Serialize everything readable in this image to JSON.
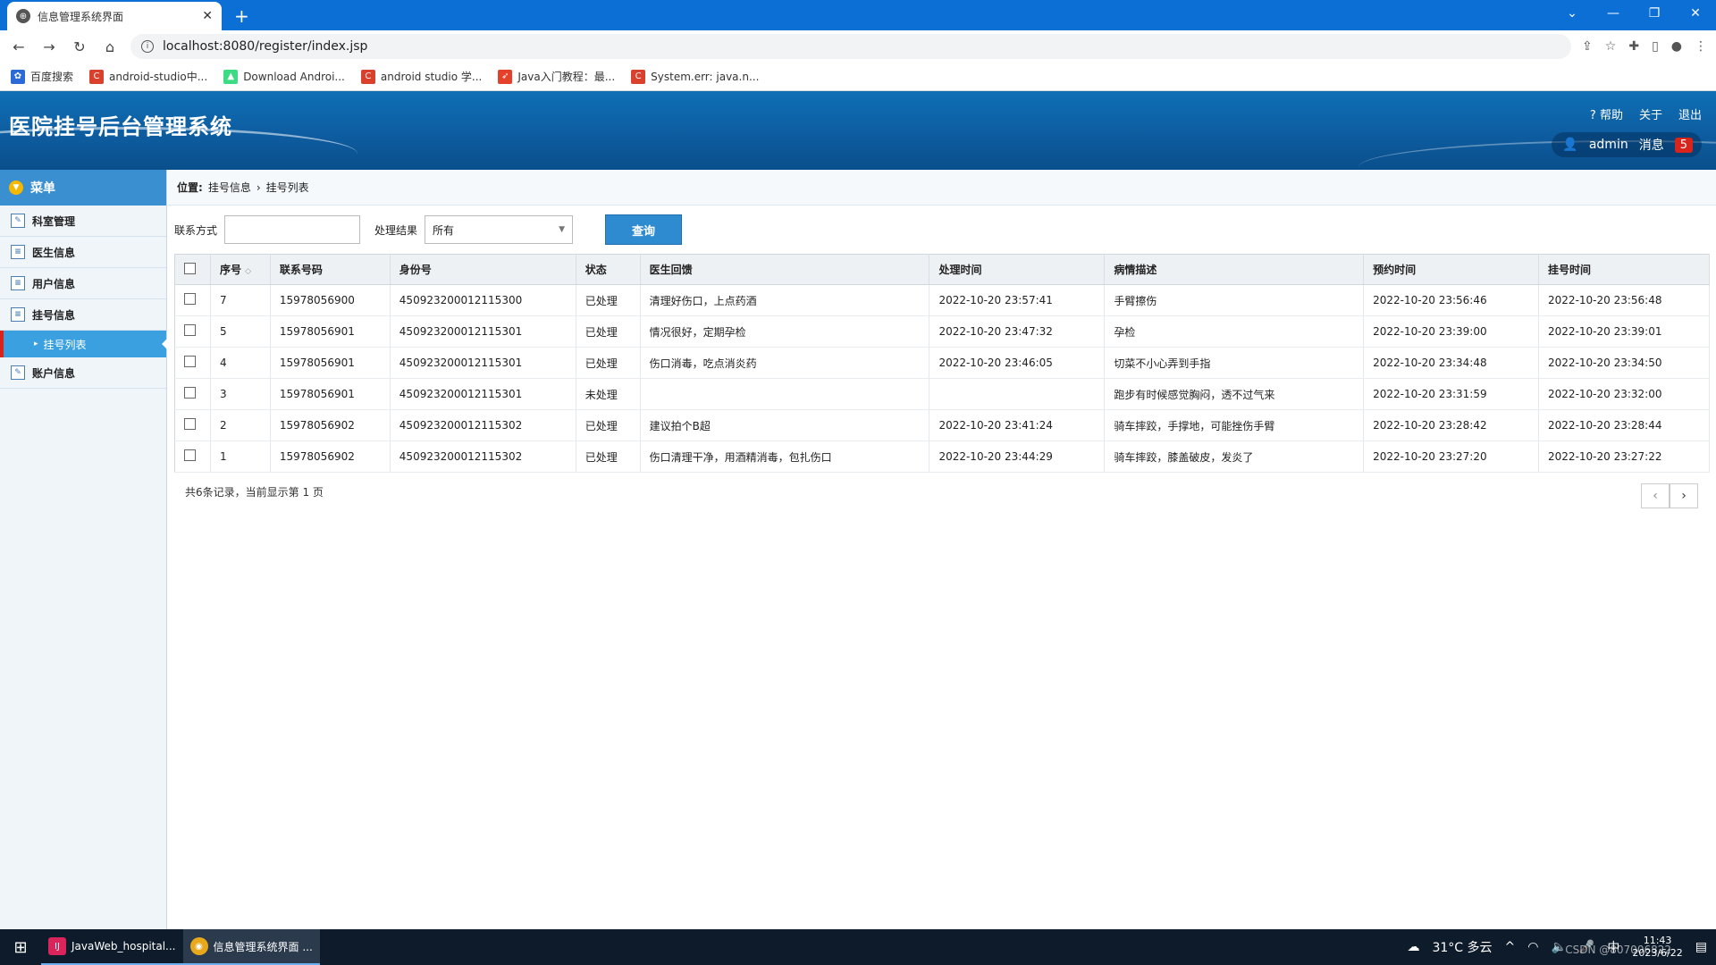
{
  "browser": {
    "tab_title": "信息管理系统界面",
    "url": "localhost:8080/register/index.jsp",
    "bookmarks": [
      {
        "label": "百度搜索",
        "color": "#2c6ad8"
      },
      {
        "label": "android-studio中...",
        "color": "#d9412c"
      },
      {
        "label": "Download Androi...",
        "color": "#3ddc84"
      },
      {
        "label": "android studio 学...",
        "color": "#d9412c"
      },
      {
        "label": "Java入门教程：最...",
        "color": "#e4402a"
      },
      {
        "label": "System.err: java.n...",
        "color": "#d9412c"
      }
    ]
  },
  "header": {
    "title": "医院挂号后台管理系统",
    "help": "帮助",
    "about": "关于",
    "logout": "退出",
    "user": "admin",
    "messages_label": "消息",
    "messages_count": "5"
  },
  "sidebar": {
    "menu_title": "菜单",
    "items": [
      {
        "label": "科室管理"
      },
      {
        "label": "医生信息"
      },
      {
        "label": "用户信息"
      },
      {
        "label": "挂号信息"
      },
      {
        "label": "挂号列表"
      },
      {
        "label": "账户信息"
      }
    ]
  },
  "breadcrumb": {
    "prefix": "位置:",
    "crumb1": "挂号信息",
    "crumb2": "挂号列表"
  },
  "filters": {
    "contact_label": "联系方式",
    "contact_value": "",
    "result_label": "处理结果",
    "result_value": "所有",
    "query_button": "查询"
  },
  "table": {
    "headers": [
      "序号",
      "联系号码",
      "身份号",
      "状态",
      "医生回馈",
      "处理时间",
      "病情描述",
      "预约时间",
      "挂号时间"
    ],
    "rows": [
      [
        "7",
        "15978056900",
        "450923200012115300",
        "已处理",
        "清理好伤口，上点药酒",
        "2022-10-20 23:57:41",
        "手臂擦伤",
        "2022-10-20 23:56:46",
        "2022-10-20 23:56:48"
      ],
      [
        "5",
        "15978056901",
        "450923200012115301",
        "已处理",
        "情况很好，定期孕检",
        "2022-10-20 23:47:32",
        "孕检",
        "2022-10-20 23:39:00",
        "2022-10-20 23:39:01"
      ],
      [
        "4",
        "15978056901",
        "450923200012115301",
        "已处理",
        "伤口消毒，吃点消炎药",
        "2022-10-20 23:46:05",
        "切菜不小心弄到手指",
        "2022-10-20 23:34:48",
        "2022-10-20 23:34:50"
      ],
      [
        "3",
        "15978056901",
        "450923200012115301",
        "未处理",
        "",
        "",
        "跑步有时候感觉胸闷，透不过气来",
        "2022-10-20 23:31:59",
        "2022-10-20 23:32:00"
      ],
      [
        "2",
        "15978056902",
        "450923200012115302",
        "已处理",
        "建议拍个B超",
        "2022-10-20 23:41:24",
        "骑车摔跤，手撑地，可能挫伤手臂",
        "2022-10-20 23:28:42",
        "2022-10-20 23:28:44"
      ],
      [
        "1",
        "15978056902",
        "450923200012115302",
        "已处理",
        "伤口清理干净，用酒精消毒，包扎伤口",
        "2022-10-20 23:44:29",
        "骑车摔跤，膝盖破皮，发炎了",
        "2022-10-20 23:27:20",
        "2022-10-20 23:27:22"
      ]
    ]
  },
  "pager": {
    "info": "共6条记录，当前显示第 1 页"
  },
  "taskbar": {
    "apps": [
      {
        "label": "JavaWeb_hospital..."
      },
      {
        "label": "信息管理系统界面 ..."
      }
    ],
    "weather": "31°C 多云",
    "time": "11:43",
    "date": "2023/6/22",
    "watermark": "CSDN @807006822"
  }
}
